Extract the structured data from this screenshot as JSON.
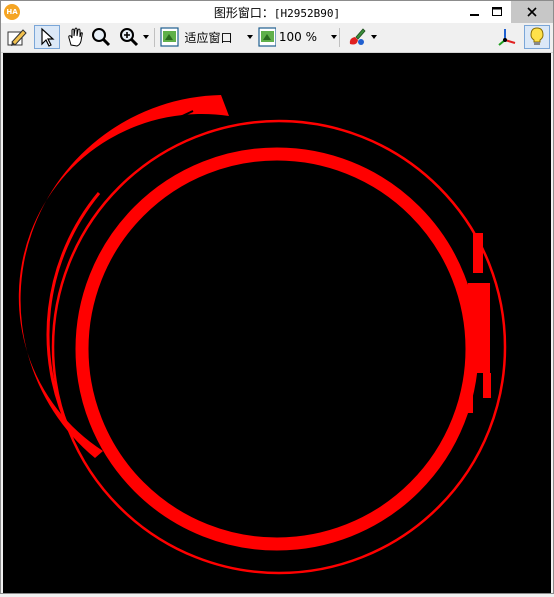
{
  "window": {
    "title_prefix": "图形窗口：",
    "window_id": "[H2952B90]"
  },
  "toolbar": {
    "fit_window_label": "适应窗口",
    "zoom_value": "100 %"
  },
  "colors": {
    "canvas_background": "#000000",
    "region_color": "#ff0000"
  },
  "icons": [
    "app-logo-icon",
    "edit-icon",
    "pointer-icon",
    "pan-hand-icon",
    "magnifier-icon",
    "zoom-in-icon",
    "fit-window-icon",
    "zoom-level-icon",
    "color-paint-icon",
    "axes-3d-icon",
    "lightbulb-icon"
  ]
}
